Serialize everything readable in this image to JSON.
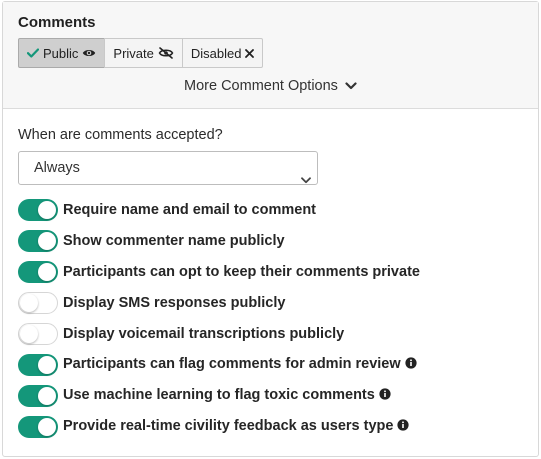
{
  "header": {
    "title": "Comments",
    "visibility_options": [
      {
        "label": "Public",
        "icon": "eye-icon",
        "selected": true
      },
      {
        "label": "Private",
        "icon": "eye-slash-icon",
        "selected": false
      },
      {
        "label": "Disabled",
        "icon": "close-icon",
        "selected": false
      }
    ],
    "more_options_label": "More Comment Options"
  },
  "acceptance": {
    "question": "When are comments accepted?",
    "selected_value": "Always"
  },
  "toggles": [
    {
      "label": "Require name and email to comment",
      "on": true,
      "info": false
    },
    {
      "label": "Show commenter name publicly",
      "on": true,
      "info": false
    },
    {
      "label": "Participants can opt to keep their comments private",
      "on": true,
      "info": false
    },
    {
      "label": "Display SMS responses publicly",
      "on": false,
      "info": false
    },
    {
      "label": "Display voicemail transcriptions publicly",
      "on": false,
      "info": false
    },
    {
      "label": "Participants can flag comments for admin review",
      "on": true,
      "info": true
    },
    {
      "label": "Use machine learning to flag toxic comments",
      "on": true,
      "info": true
    },
    {
      "label": "Provide real-time civility feedback as users type",
      "on": true,
      "info": true
    }
  ],
  "colors": {
    "toggle_on": "#14977a",
    "check": "#14977a"
  }
}
